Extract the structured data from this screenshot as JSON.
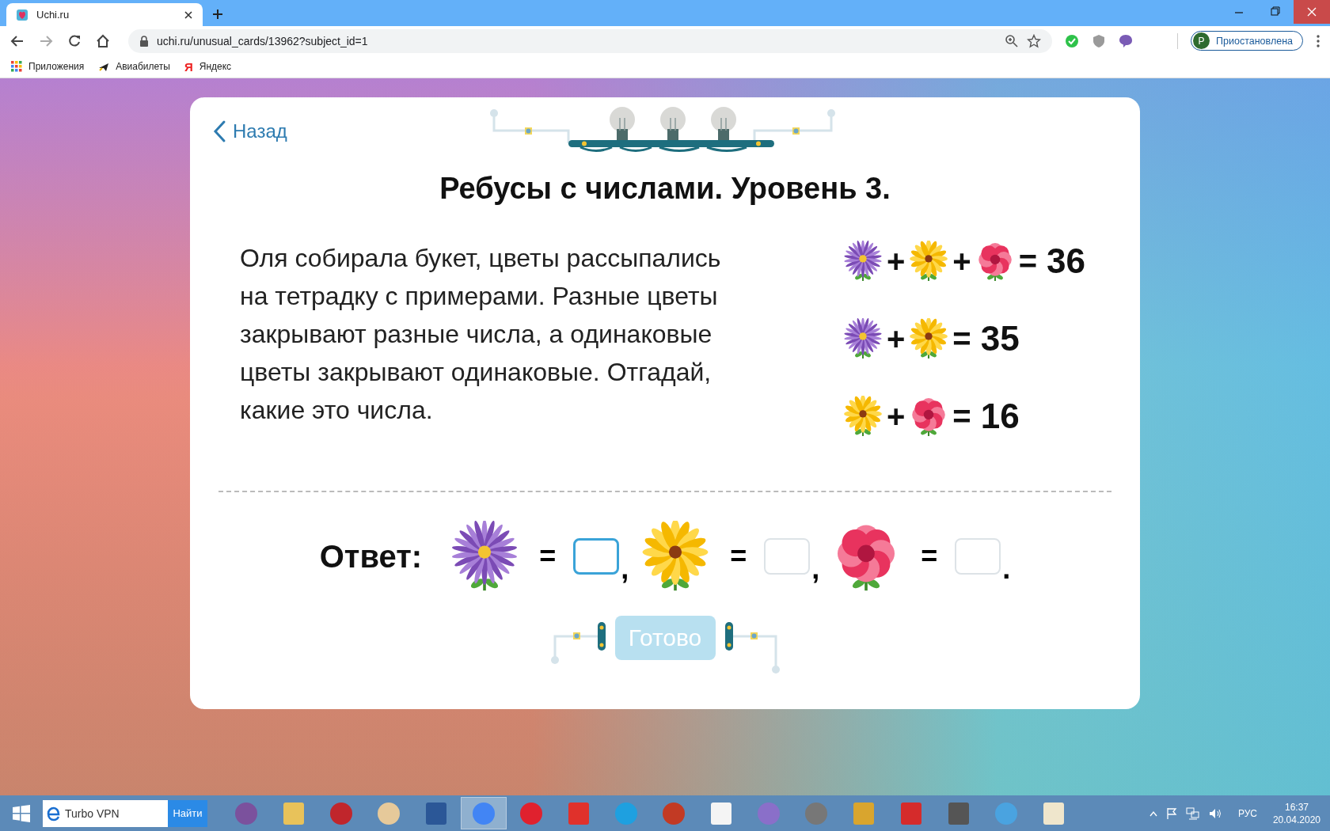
{
  "browser": {
    "tab": {
      "title": "Uchi.ru",
      "selected": true
    },
    "address": "uchi.ru/unusual_cards/13962?subject_id=1",
    "bookmarks": [
      {
        "kind": "apps",
        "label": "Приложения"
      },
      {
        "kind": "plane",
        "label": "Авиабилеты"
      },
      {
        "kind": "letter",
        "icon": "Я",
        "label": "Яндекс"
      }
    ],
    "profile": {
      "initial": "P",
      "label": "Приостановлена"
    }
  },
  "card": {
    "back": "Назад",
    "title": "Ребусы с числами. Уровень 3.",
    "problem": "Оля собирала букет, цветы рассыпались на тетрадку с примерами. Разные цветы закрывают разные числа, а одинаковые цветы закрывают одинаковые. Отгадай, какие это числа.",
    "equations": [
      {
        "parts": [
          {
            "kind": "purple"
          },
          {
            "kind": "sign",
            "text": "+"
          },
          {
            "kind": "yellow"
          },
          {
            "kind": "sign",
            "text": "+"
          },
          {
            "kind": "red"
          },
          {
            "kind": "sign",
            "text": "="
          },
          {
            "kind": "number",
            "text": "36"
          }
        ]
      },
      {
        "parts": [
          {
            "kind": "purple"
          },
          {
            "kind": "sign",
            "text": "+"
          },
          {
            "kind": "yellow"
          },
          {
            "kind": "sign",
            "text": "="
          },
          {
            "kind": "number",
            "text": "35"
          }
        ]
      },
      {
        "parts": [
          {
            "kind": "yellow"
          },
          {
            "kind": "sign",
            "text": "+"
          },
          {
            "kind": "red"
          },
          {
            "kind": "sign",
            "text": "="
          },
          {
            "kind": "number",
            "text": "16"
          }
        ]
      }
    ],
    "answer": {
      "label": "Ответ:",
      "items": [
        {
          "kind": "purple",
          "equals": "=",
          "selected": true,
          "after": ","
        },
        {
          "kind": "yellow",
          "equals": "=",
          "selected": false,
          "after": ","
        },
        {
          "kind": "red",
          "equals": "=",
          "selected": false,
          "after": "."
        }
      ]
    },
    "done_button": {
      "label": "Готово",
      "disabled": true
    }
  },
  "taskbar": {
    "search": {
      "value": "Turbo VPN",
      "button": "Найти"
    },
    "apps": [
      {
        "kind": "viber",
        "selected": false
      },
      {
        "kind": "folder",
        "selected": false
      },
      {
        "kind": "gear",
        "selected": false
      },
      {
        "kind": "palette",
        "selected": false
      },
      {
        "kind": "document",
        "selected": false
      },
      {
        "kind": "chrome",
        "selected": true
      },
      {
        "kind": "opera",
        "selected": false
      },
      {
        "kind": "yandex",
        "selected": false
      },
      {
        "kind": "skype",
        "selected": false
      },
      {
        "kind": "ball",
        "selected": false
      },
      {
        "kind": "card",
        "selected": false
      },
      {
        "kind": "spider",
        "selected": false
      },
      {
        "kind": "mine",
        "selected": false
      },
      {
        "kind": "king",
        "selected": false
      },
      {
        "kind": "heart",
        "selected": false
      },
      {
        "kind": "chess",
        "selected": false
      },
      {
        "kind": "eyes",
        "selected": false
      },
      {
        "kind": "mahjong",
        "selected": false
      }
    ],
    "language": "РУС",
    "time": "16:37",
    "date": "20.04.2020"
  }
}
